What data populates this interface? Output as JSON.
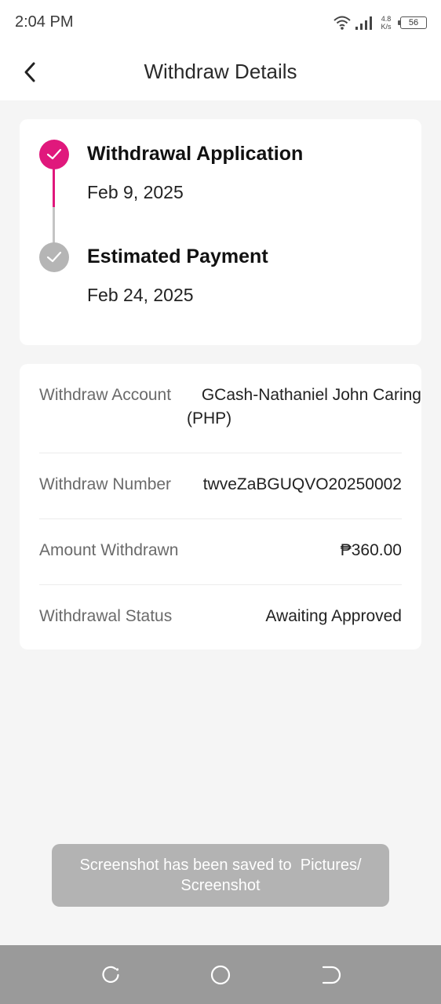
{
  "status_bar": {
    "time": "2:04 PM",
    "net_speed_value": "4.8",
    "net_speed_unit": "K/s",
    "battery": "56",
    "icons": [
      "wifi-icon",
      "signal-icon",
      "battery-icon"
    ]
  },
  "header": {
    "title": "Withdraw Details",
    "back_icon": "chevron-left-icon"
  },
  "timeline": {
    "steps": [
      {
        "title": "Withdrawal Application",
        "date": "Feb 9, 2025",
        "state": "done"
      },
      {
        "title": "Estimated Payment",
        "date": "Feb 24, 2025",
        "state": "pending"
      }
    ]
  },
  "details": {
    "rows": [
      {
        "label": "Withdraw Account",
        "value_line1": "GCash-Nathaniel John Caring",
        "value_line2": "(PHP)"
      },
      {
        "label": "Withdraw Number",
        "value": "twveZaBGUQVO20250002"
      },
      {
        "label": "Amount Withdrawn",
        "value": "₱360.00"
      },
      {
        "label": "Withdrawal Status",
        "value": "Awaiting Approved"
      }
    ]
  },
  "toast": {
    "line1": "Screenshot has been saved to  Pictures/",
    "line2": "Screenshot"
  },
  "nav_bar": {
    "buttons": [
      "recent-apps-icon",
      "home-icon",
      "back-icon"
    ]
  },
  "colors": {
    "accent": "#e0187c",
    "pending": "#b5b5b5",
    "background": "#f5f5f5",
    "nav_bar": "#9a9a9a",
    "toast": "#b3b3b3"
  }
}
